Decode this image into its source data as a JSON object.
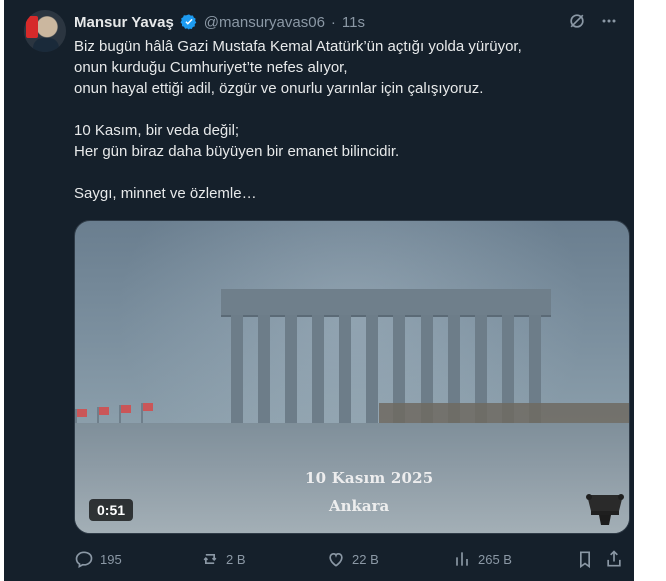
{
  "tweet": {
    "author_name": "Mansur Yavaş",
    "handle": "@mansuryavas06",
    "separator": "·",
    "time": "11s",
    "text_lines": [
      "Biz bugün hâlâ Gazi Mustafa Kemal Atatürk’ün açtığı yolda yürüyor,",
      "onun kurduğu Cumhuriyet’te nefes alıyor,",
      "onun hayal ettiği adil, özgür ve onurlu yarınlar için çalışıyoruz.",
      "",
      "10 Kasım, bir veda değil;",
      "Her gün biraz daha büyüyen bir emanet bilincidir.",
      "",
      "Saygı, minnet ve özlemle…"
    ],
    "media": {
      "watermark_line1": "10 Kasım 2025",
      "watermark_line2": "Ankara",
      "duration": "0:51"
    },
    "actions": {
      "replies": "195",
      "reposts": "2 B",
      "likes": "22 B",
      "views": "265 B"
    },
    "icons": {
      "verified": "verified-badge-icon",
      "hide": "slash-circle-icon",
      "more": "more-dots-icon",
      "reply": "reply-icon",
      "repost": "repost-icon",
      "like": "heart-icon",
      "views": "views-icon",
      "bookmark": "bookmark-icon",
      "share": "share-icon"
    },
    "colors": {
      "background": "#15202b",
      "text": "#e7e9ea",
      "muted": "#8b98a5",
      "verified": "#1d9bf0"
    }
  }
}
